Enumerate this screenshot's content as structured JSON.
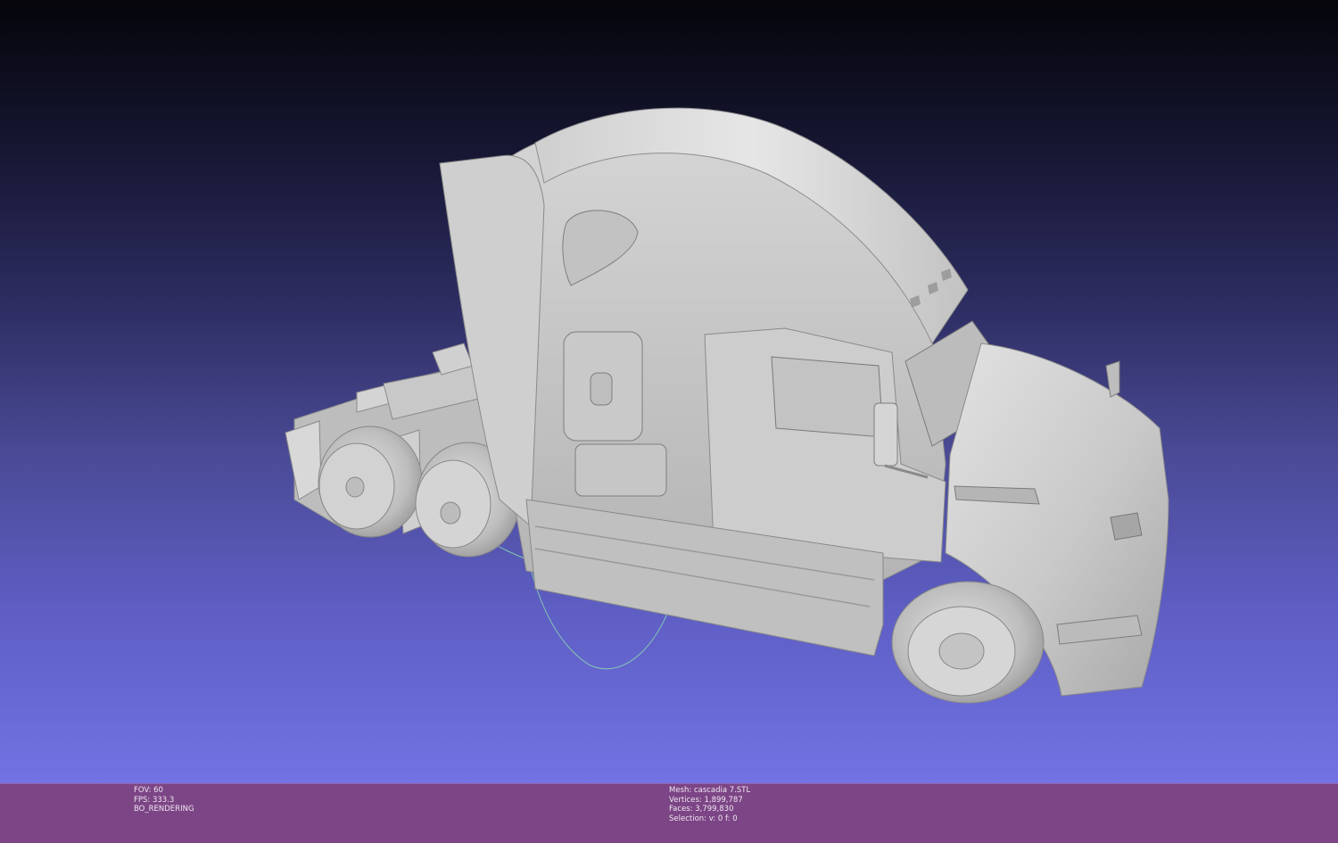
{
  "app": {
    "viewport_label": "3D mesh viewport"
  },
  "colors": {
    "background_top": "#05050a",
    "background_bottom": "#7272e4",
    "mesh_shade": "#c8c8c8",
    "trackball": "#8fe0b0",
    "statusbar": "#7c4585"
  },
  "render_info": {
    "fov_label": "FOV:",
    "fov_value": "60",
    "fps_label": "FPS:",
    "fps_value": "333.3",
    "mode": "BO_RENDERING"
  },
  "mesh_info": {
    "mesh": "Mesh: cascadia 7.STL",
    "vertices": "Vertices: 1,899,787",
    "faces": "Faces: 3,799,830",
    "selection": "Selection: v: 0 f: 0"
  },
  "model": {
    "name": "cascadia 7.STL",
    "subject": "semi-truck-tractor"
  }
}
